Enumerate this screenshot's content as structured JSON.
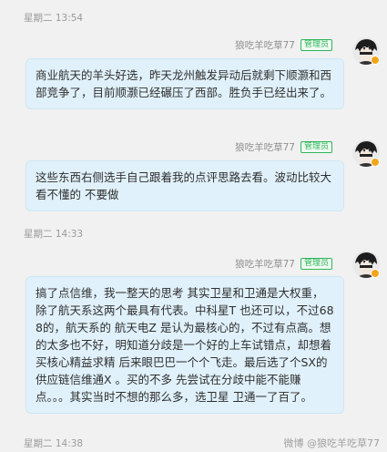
{
  "messages": [
    {
      "time": "星期二 13:54",
      "sender": "狼吃羊吃草77",
      "badge": "管理员",
      "text": "商业航天的羊头好选，昨天龙州触发异动后就剩下顺灏和西部竞争了，目前顺灏已经碾压了西部。胜负手已经出来了。"
    },
    {
      "sender": "狼吃羊吃草77",
      "badge": "管理员",
      "text": "这些东西右侧选手自己跟着我的点评思路去看。波动比较大 看不懂的 不要做"
    },
    {
      "time": "星期二 14:33",
      "sender": "狼吃羊吃草77",
      "badge": "管理员",
      "text": "搞了点信维，我一整天的思考 其实卫星和卫通是大权重，除了航天系这两个最具有代表。中科星T 也还可以，不过688的，航天系的 航天电Z 是认为最核心的，不过有点高。想的太多也不好，明知道分歧是一个好的上车试错点，却想着买核心精益求精 后来眼巴巴一个个飞走。最后选了个SX的供应链信维通X 。买的不多 先尝试在分歧中能不能赚点。。。其实当时不想的那么多，选卫星 卫通一了百了。"
    },
    {
      "time": "星期二 14:38"
    }
  ],
  "watermark": "微博 @狼吃羊吃草77",
  "colors": {
    "bubble": "#e0f1fb",
    "badge": "#2fb55a",
    "background": "#f1f1f1"
  }
}
